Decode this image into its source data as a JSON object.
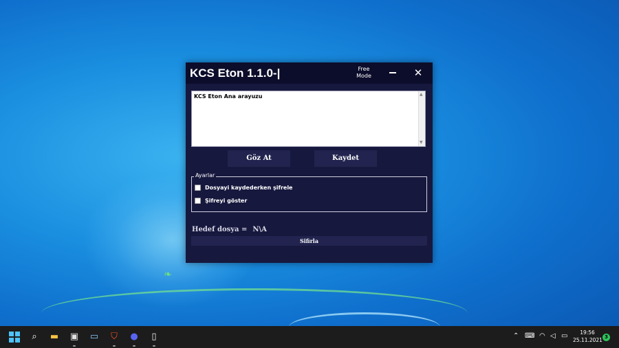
{
  "window": {
    "title": "KCS Eton 1.1.0-|",
    "mode_line1": "Free",
    "mode_line2": "Mode",
    "close_glyph": "✕",
    "textarea_text": "KCS Eton Ana arayuzu",
    "browse_label": "Göz At",
    "save_label": "Kaydet",
    "settings_legend": "Ayarlar",
    "encrypt_on_save_label": "Dosyayi kaydederken şifrele",
    "show_password_label": "Şifreyi göster",
    "encrypt_on_save_checked": false,
    "show_password_checked": false,
    "target_label": "Hedef dosya =",
    "target_value": "N\\A",
    "reset_label": "Sifirla"
  },
  "taskbar": {
    "icons": [
      "windows-start-icon",
      "search-icon",
      "file-explorer-icon",
      "toolbox-icon",
      "photos-icon",
      "brave-browser-icon",
      "discord-icon",
      "document-icon"
    ],
    "clock_time": "19:56",
    "clock_date": "25.11.2021",
    "notification_count": "3"
  },
  "colors": {
    "window_bg": "#17183e",
    "titlebar_bg": "#0c0d2a",
    "button_bg": "#22244f",
    "taskbar_bg": "#1c1c1c",
    "notification_badge": "#2ec45a"
  }
}
